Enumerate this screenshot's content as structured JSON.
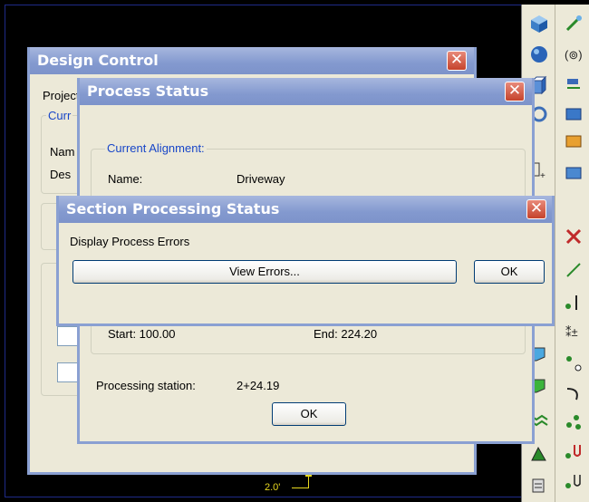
{
  "design_control": {
    "title": "Design Control",
    "close_glyph": "✕",
    "tab_label": "Project",
    "group_label": "Curr",
    "name_label": "Nam",
    "desc_label": "Des"
  },
  "process_status": {
    "title": "Process Status",
    "close_glyph": "✕",
    "group_label": "Current Alignment:",
    "name_label": "Name:",
    "name_value": "Driveway",
    "start_label": "Start: 100.00",
    "end_label": "End: 224.20",
    "processing_label": "Processing station:",
    "processing_value": "2+24.19",
    "ok_label": "OK"
  },
  "section_status": {
    "title": "Section Processing Status",
    "close_glyph": "✕",
    "message": "Display Process Errors",
    "view_errors_label": "View Errors...",
    "ok_label": "OK"
  },
  "canvas": {
    "dimension_text": "2.0'"
  },
  "toolbar": {
    "icons": [
      "cube-icon",
      "sphere-icon",
      "box-icon",
      "ring-icon",
      "tool-a-icon",
      "tool-b-icon",
      "tool-c-icon",
      "tool-d-icon",
      "tool-e-icon",
      "tool-f-icon",
      "tool-g-icon",
      "tool-h-icon",
      "tool-i-icon",
      "tool-j-icon"
    ]
  }
}
